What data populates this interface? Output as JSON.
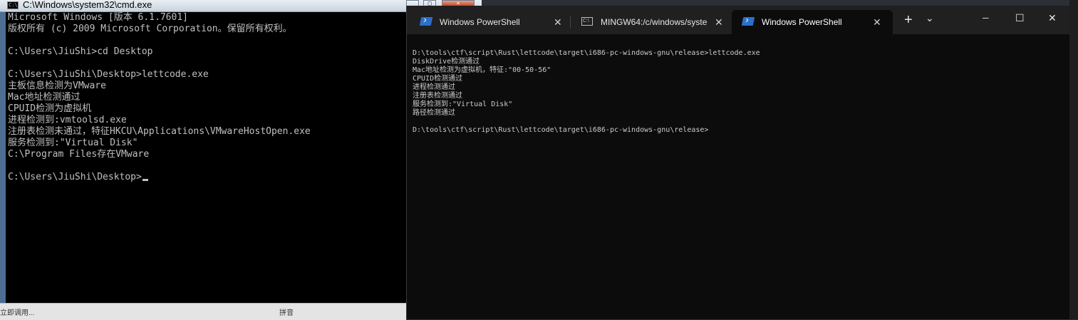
{
  "cmd": {
    "title": "C:\\Windows\\system32\\cmd.exe",
    "icon": "cmd-icon",
    "controls": [
      "minimize",
      "maximize",
      "close"
    ],
    "lines": [
      "Microsoft Windows [版本 6.1.7601]",
      "版权所有 (c) 2009 Microsoft Corporation。保留所有权利。",
      "",
      "C:\\Users\\JiuShi>cd Desktop",
      "",
      "C:\\Users\\JiuShi\\Desktop>lettcode.exe",
      "主板信息检测为VMware",
      "Mac地址检测通过",
      "CPUID检测为虚拟机",
      "进程检测到:vmtoolsd.exe",
      "注册表检测未通过，特征HKCU\\Applications\\VMwareHostOpen.exe",
      "服务检测到:\"Virtual Disk\"",
      "C:\\Program Files存在VMware",
      "",
      "C:\\Users\\JiuShi\\Desktop>"
    ],
    "status_left": "立即调用...",
    "status_mid": "拼音"
  },
  "terminal": {
    "tabs": [
      {
        "label": "Windows PowerShell",
        "icon": "powershell-icon",
        "active": false
      },
      {
        "label": "MINGW64:/c/windows/syste",
        "icon": "console-icon",
        "active": false
      },
      {
        "label": "Windows PowerShell",
        "icon": "powershell-icon",
        "active": true
      }
    ],
    "new_tab": "+",
    "dropdown": "⌄",
    "window_controls": {
      "minimize": "─",
      "maximize": "☐",
      "close": "✕"
    },
    "lines": [
      "D:\\tools\\ctf\\script\\Rust\\lettcode\\target\\i686-pc-windows-gnu\\release>lettcode.exe",
      "DiskDrive检测通过",
      "Mac地址检测为虚拟机，特征:\"00-50-56\"",
      "CPUID检测通过",
      "进程检测通过",
      "注册表检测通过",
      "服务检测到:\"Virtual Disk\"",
      "路径检测通过",
      "",
      "D:\\tools\\ctf\\script\\Rust\\lettcode\\target\\i686-pc-windows-gnu\\release>"
    ]
  }
}
